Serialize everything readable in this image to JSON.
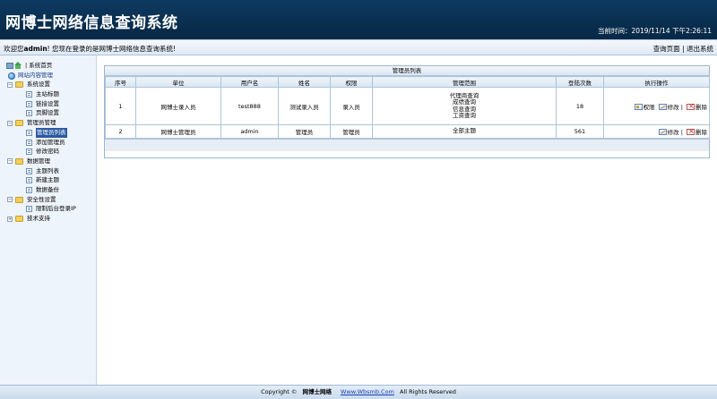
{
  "header": {
    "title": "网博士网络信息查询系统",
    "clock_label": "当前时间：",
    "clock_value": "2019/11/14 下午2:26:11"
  },
  "welcome": {
    "prefix": "欢迎您",
    "user": "admin",
    "suffix": "! 您现在登录的是网博士网络信息查询系统!",
    "link_query": "查询页面",
    "separator": "|",
    "link_logout": "退出系统"
  },
  "sidebar": {
    "home": "| 系统首页",
    "root": "网站内容管理",
    "groups": [
      {
        "label": "系统设置",
        "items": [
          "主站标题",
          "链接设置",
          "页脚设置"
        ]
      },
      {
        "label": "管理员管理",
        "items": [
          "管理员列表",
          "添加管理员",
          "修改密码"
        ],
        "selected": 0
      },
      {
        "label": "数据管理",
        "items": [
          "主题列表",
          "新建主题",
          "数据备份"
        ]
      },
      {
        "label": "安全性设置",
        "items": [
          "限制后台登录IP"
        ]
      },
      {
        "label": "技术支持",
        "items": []
      }
    ]
  },
  "panel": {
    "title": "管理员列表",
    "columns": [
      "序号",
      "单位",
      "用户名",
      "姓名",
      "权限",
      "管理范围",
      "登陆次数",
      "执行操作"
    ],
    "rows": [
      {
        "no": "1",
        "unit": "网博士录入员",
        "username": "test888",
        "name": "测试录入员",
        "role": "录入员",
        "scope": [
          "代理商查询",
          "成绩查询",
          "信息查询",
          "工资查询"
        ],
        "logins": "18",
        "ops": {
          "perm": "权限",
          "edit": "修改",
          "sep": "|",
          "del": "删除"
        }
      },
      {
        "no": "2",
        "unit": "网博士管理员",
        "username": "admin",
        "name": "管理员",
        "role": "管理员",
        "scope": [
          "全部主题"
        ],
        "logins": "561",
        "ops": {
          "edit": "修改",
          "sep": "|",
          "del": "删除"
        }
      }
    ]
  },
  "footer": {
    "copyright": "Copyright ©",
    "brand": "网博士网络",
    "site": "Www.Wbsmb.Com",
    "rights": "All Rights Reserved"
  },
  "colors": {
    "header_bg": "#0a2f50",
    "selected_bg": "#2a5aa0",
    "link": "#1a3fb8",
    "delete": "#d02020"
  }
}
